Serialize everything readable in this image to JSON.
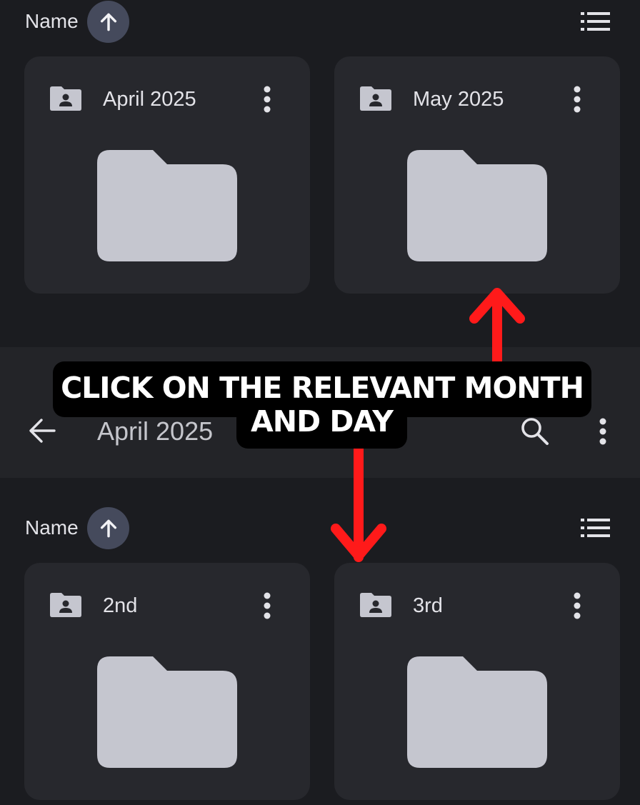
{
  "top_panel": {
    "sort_label": "Name",
    "cards": [
      {
        "title": "April 2025"
      },
      {
        "title": "May 2025"
      }
    ]
  },
  "app_bar": {
    "title": "April 2025"
  },
  "bottom_panel": {
    "sort_label": "Name",
    "cards": [
      {
        "title": "2nd"
      },
      {
        "title": "3rd"
      }
    ]
  },
  "caption": {
    "line1": "CLICK ON THE RELEVANT MONTH",
    "line2": "AND DAY"
  },
  "colors": {
    "background": "#1b1c20",
    "card": "#27282d",
    "app_bar": "#232428",
    "sort_button": "#454a5c",
    "folder": "#c5c6cf",
    "arrow": "#ff1a1a",
    "caption_bg": "#000000"
  },
  "icons": [
    "arrow-up-icon",
    "list-view-icon",
    "shared-folder-icon",
    "more-vert-icon",
    "folder-icon",
    "back-arrow-icon",
    "search-icon"
  ]
}
